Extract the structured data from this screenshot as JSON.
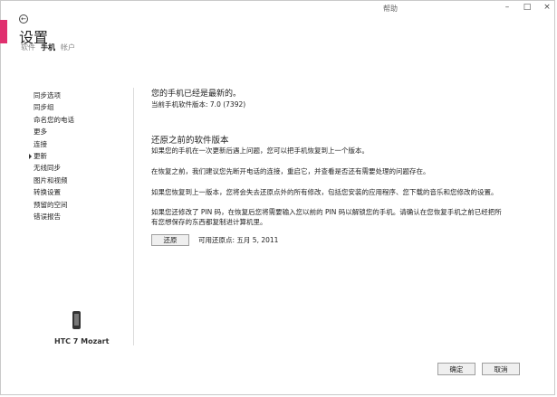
{
  "window": {
    "help_label": "帮助",
    "minimize": "–",
    "maximize": "□",
    "close": "×"
  },
  "header": {
    "title": "设置",
    "pivots": [
      "软件",
      "手机",
      "帐户"
    ],
    "active_pivot": "手机"
  },
  "sidebar": {
    "items": [
      {
        "label": "同步选项"
      },
      {
        "label": "同步组"
      },
      {
        "label": "命名您的电话"
      },
      {
        "label": "更多"
      },
      {
        "label": "连接"
      },
      {
        "label": "更新",
        "selected": true
      },
      {
        "label": "无线同步"
      },
      {
        "label": "图片和视频"
      },
      {
        "label": "转换设置"
      },
      {
        "label": "预留的空间"
      },
      {
        "label": "错误报告"
      }
    ],
    "device_name": "HTC 7 Mozart"
  },
  "main": {
    "status": "您的手机已经是最新的。",
    "version": "当前手机软件版本: 7.0 (7392)",
    "restore_section_title": "还原之前的软件版本",
    "paragraphs": [
      "如果您的手机在一次更新后遇上问题，您可以把手机恢复到上一个版本。",
      "在恢复之前，我们建议您先断开电话的连接，重启它，并查看是否还有需要处理的问题存在。",
      "如果您恢复到上一版本，您将会失去还原点外的所有修改，包括您安装的应用程序、您下载的音乐和您修改的设置。"
    ],
    "pin_note_line1": "如果您还修改了 PIN 码，在恢复后您将需要输入您以前的 PIN 码以解锁您的手机。请确认在您恢复手机之前已经把所",
    "pin_note_line2": "有您想保存的东西都复制进计算机里。",
    "restore_button": "还原",
    "restore_point": "可用还原点: 五月 5, 2011"
  },
  "footer": {
    "ok": "确定",
    "cancel": "取消"
  }
}
